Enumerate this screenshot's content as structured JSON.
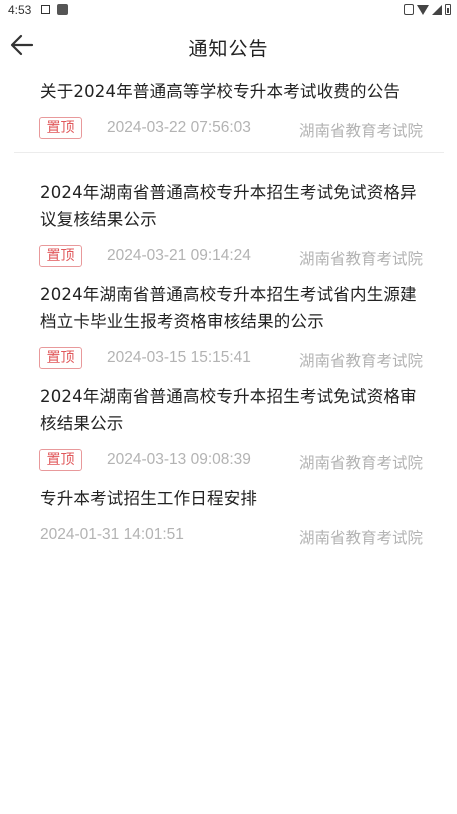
{
  "status_bar": {
    "time": "4:53"
  },
  "header": {
    "title": "通知公告"
  },
  "notices": [
    {
      "title": "关于2024年普通高等学校专升本考试收费的公告",
      "pin_label": "置顶",
      "date": "2024-03-22 07:56:03",
      "source": "湖南省教育考试院"
    },
    {
      "title": "2024年湖南省普通高校专升本招生考试免试资格异议复核结果公示",
      "pin_label": "置顶",
      "date": "2024-03-21 09:14:24",
      "source": "湖南省教育考试院"
    },
    {
      "title": "2024年湖南省普通高校专升本招生考试省内生源建档立卡毕业生报考资格审核结果的公示",
      "pin_label": "置顶",
      "date": "2024-03-15 15:15:41",
      "source": "湖南省教育考试院"
    },
    {
      "title": "2024年湖南省普通高校专升本招生考试免试资格审核结果公示",
      "pin_label": "置顶",
      "date": "2024-03-13 09:08:39",
      "source": "湖南省教育考试院"
    },
    {
      "title": "专升本考试招生工作日程安排",
      "date": "2024-01-31 14:01:51",
      "source": "湖南省教育考试院"
    }
  ]
}
